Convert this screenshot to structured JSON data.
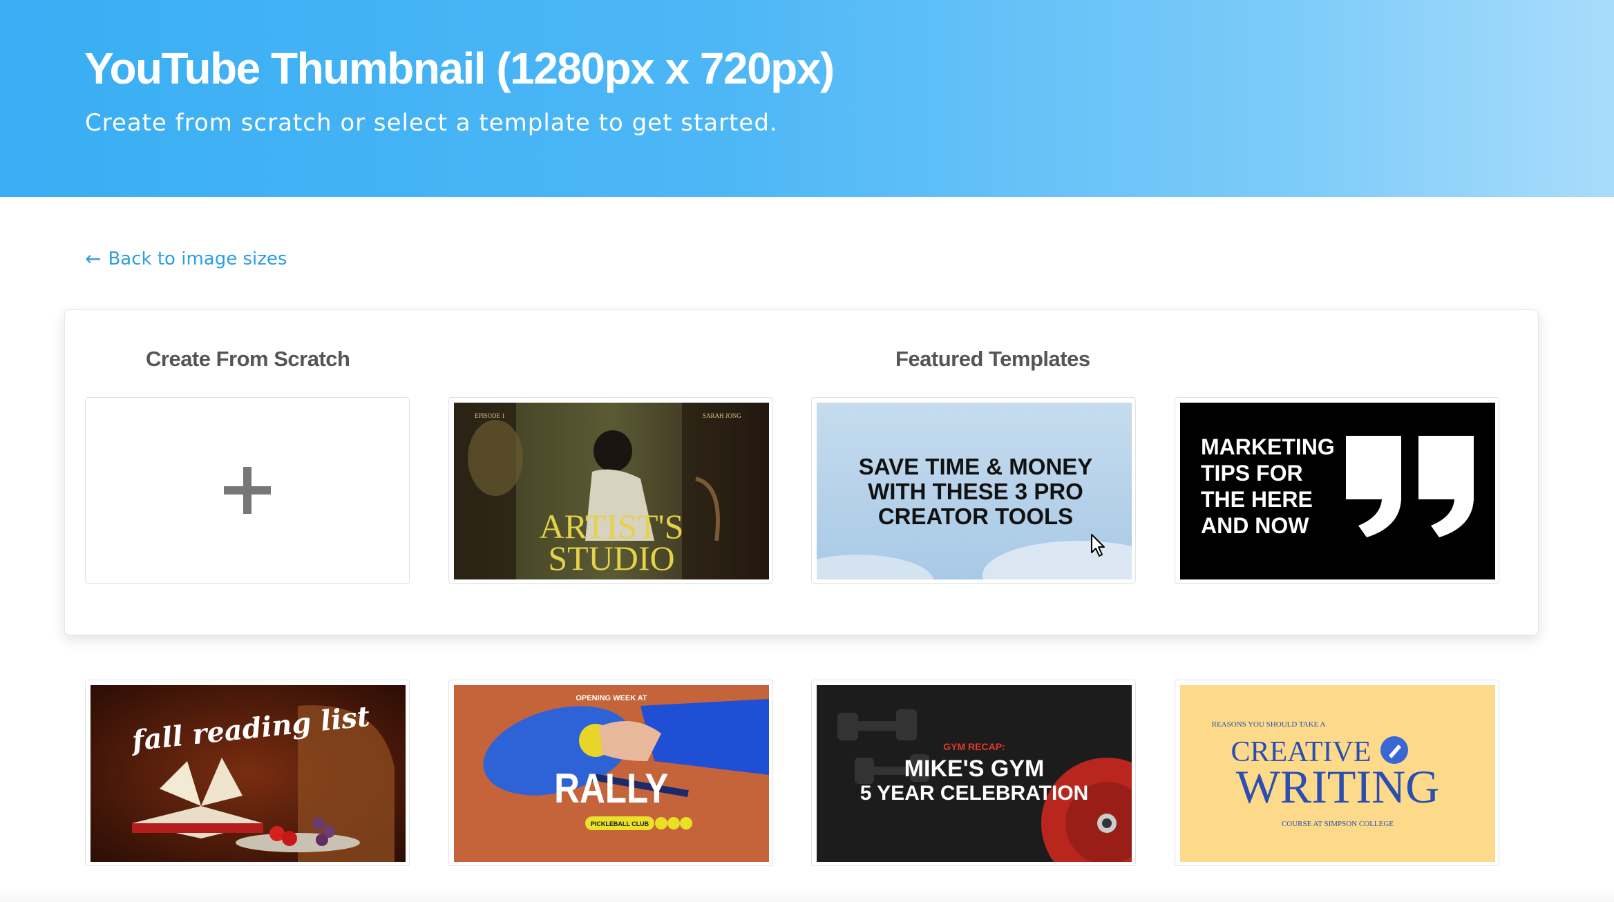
{
  "header": {
    "title": "YouTube Thumbnail (1280px x 720px)",
    "subtitle": "Create from scratch or select a template to get started."
  },
  "nav": {
    "back_label": "Back to image sizes",
    "back_icon": "arrow-left-icon"
  },
  "sections": {
    "scratch_heading": "Create From Scratch",
    "templates_heading": "Featured Templates"
  },
  "scratch_card": {
    "icon": "plus-icon"
  },
  "templates": [
    {
      "name": "artists-studio",
      "title_line1": "ARTIST'S",
      "title_line2": "STUDIO",
      "corner_left": "EPISODE 1",
      "corner_right": "SARAH JONG"
    },
    {
      "name": "creator-tools",
      "line1": "SAVE TIME & MONEY",
      "line2": "WITH THESE 3 PRO",
      "line3": "CREATOR TOOLS"
    },
    {
      "name": "marketing-tips",
      "line1": "MARKETING",
      "line2": "TIPS FOR",
      "line3": "THE HERE",
      "line4": "AND NOW"
    },
    {
      "name": "fall-reading-list",
      "title": "fall reading list"
    },
    {
      "name": "rally-pickleball",
      "kicker": "OPENING WEEK AT",
      "title": "RALLY",
      "badge": "PICKLEBALL CLUB"
    },
    {
      "name": "mikes-gym",
      "kicker": "GYM RECAP:",
      "line1": "MIKE'S GYM",
      "line2": "5 YEAR CELEBRATION"
    },
    {
      "name": "creative-writing",
      "kicker": "REASONS YOU SHOULD TAKE A",
      "line1": "CREATIVE",
      "line2": "WRITING",
      "footer": "COURSE AT SIMPSON COLLEGE"
    }
  ],
  "colors": {
    "header_start": "#39aef4",
    "header_end": "#a9dcfb",
    "link": "#2b9fe0",
    "heading": "#555555"
  }
}
